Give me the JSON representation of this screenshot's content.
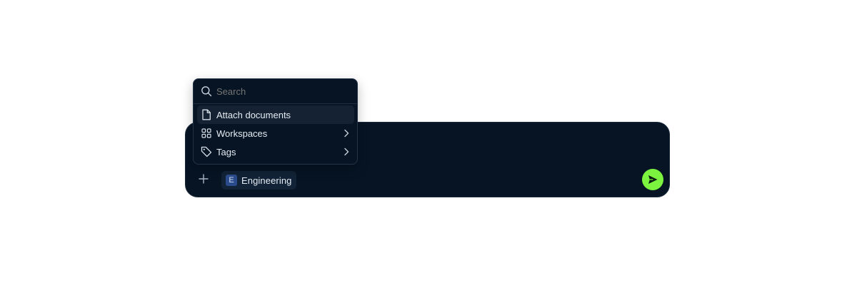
{
  "menu": {
    "search": {
      "value": "",
      "placeholder": "Search",
      "icon": "search-icon"
    },
    "items": [
      {
        "label": "Attach documents",
        "icon": "document-icon",
        "has_submenu": false,
        "highlighted": true
      },
      {
        "label": "Workspaces",
        "icon": "grid-icon",
        "has_submenu": true,
        "highlighted": false
      },
      {
        "label": "Tags",
        "icon": "tag-icon",
        "has_submenu": true,
        "highlighted": false
      }
    ]
  },
  "composer": {
    "add_icon": "plus-icon",
    "chip": {
      "badge": "E",
      "label": "Engineering"
    },
    "send_icon": "send-icon"
  },
  "colors": {
    "panel_bg": "#061424",
    "accent_send": "#7bf33f",
    "chip_bg": "#122337",
    "badge_bg": "#2b4c8c"
  }
}
